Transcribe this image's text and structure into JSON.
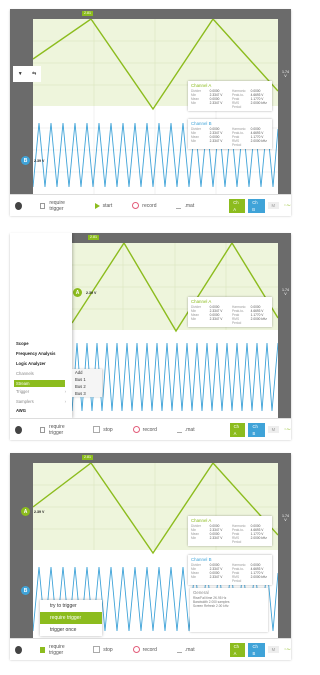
{
  "colors": {
    "channel_a": "#8cbc1e",
    "channel_b": "#3fa3d8",
    "background": "#6b6b6b",
    "record": "#e35d7a"
  },
  "top_marker": "2.81",
  "left_level": "2.39 V",
  "right_labels": [
    "1.74",
    "V"
  ],
  "channel_a_badge": "A",
  "channel_b_badge": "B",
  "info_a": {
    "title": "Channel A",
    "col1_labels": [
      "Divider",
      "Min",
      "Mean",
      "Min"
    ],
    "col1_values": [
      "0.0000",
      "2.3347 V",
      "0.0000",
      "2.3347 V"
    ],
    "col2_labels": [
      "Harmonic",
      "Peak-to-Peak",
      "RMS",
      "Period"
    ],
    "col2_values": [
      "0.0000",
      "4.6693 V",
      "1.1770 V",
      "2.0000 kHz"
    ]
  },
  "info_b": {
    "title": "Channel B",
    "col1_labels": [
      "Divider",
      "Min",
      "Mean",
      "Min"
    ],
    "col1_values": [
      "0.0000",
      "2.3347 V",
      "0.0000",
      "2.3347 V"
    ],
    "col2_labels": [
      "Harmonic",
      "Peak-to-Peak",
      "RMS",
      "Period"
    ],
    "col2_values": [
      "0.0000",
      "4.6693 V",
      "1.1770 V",
      "2.0000 kHz"
    ]
  },
  "bottom": {
    "require_trigger": "require trigger",
    "start": "start",
    "stop": "stop",
    "record": "record",
    "mat": ".mat",
    "ch_a": "Ch A",
    "ch_b": "Ch B",
    "math": "M"
  },
  "toolbar_float": {
    "trigger_label": "trigger",
    "scale_label": "scale"
  },
  "menu": {
    "items": [
      "Scope",
      "Frequency Analysis",
      "Logic Analyzer"
    ],
    "channels": "Channels",
    "stream": "Stream",
    "trigger": "Trigger",
    "samplers": "Samplers",
    "awg": "AWG",
    "submenu": [
      "Add",
      "Bus 1",
      "Bus 2",
      "Bus 3"
    ]
  },
  "trigger_popup": [
    "try to trigger",
    "require trigger",
    "trigger once"
  ],
  "generator": {
    "title": "General",
    "rows": [
      [
        "Rise/Fall time",
        "2K.95 Hz"
      ],
      [
        "Bandwidth",
        "2.000 samples"
      ],
      [
        "Screen Refresh",
        "2.00 kHz"
      ]
    ]
  }
}
